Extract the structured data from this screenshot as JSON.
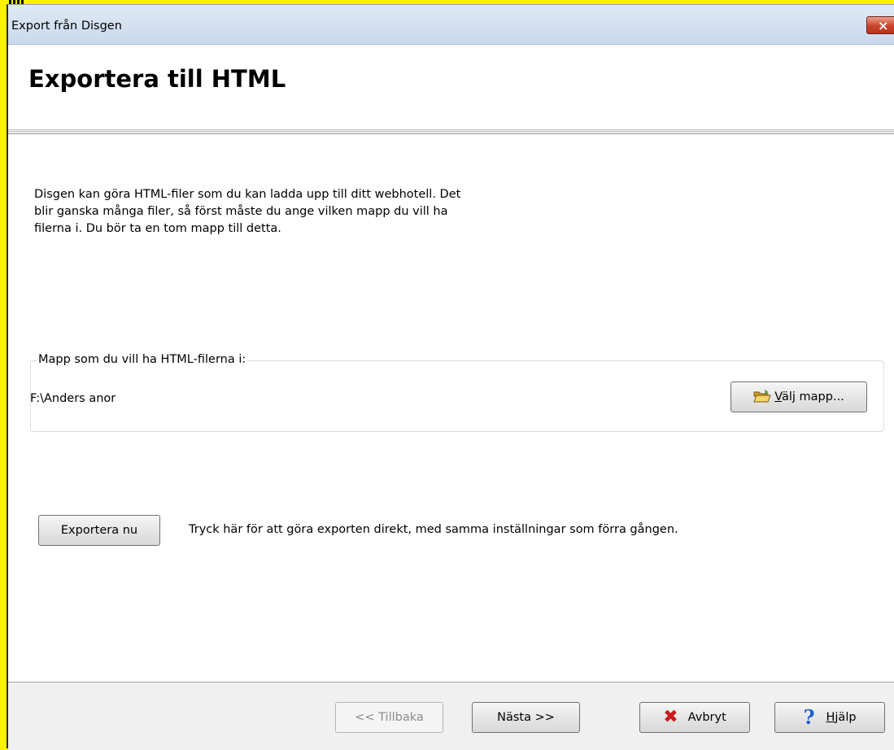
{
  "window": {
    "title": "Export från Disgen",
    "close_label": "×"
  },
  "header": {
    "title": "Exportera till HTML"
  },
  "content": {
    "intro_line1": "Disgen kan göra HTML-filer som du kan ladda upp till ditt webhotell. Det",
    "intro_line2": "blir ganska många filer, så först måste du ange vilken mapp du vill ha",
    "intro_line3": "filerna i. Du bör ta en tom mapp till detta.",
    "folder_group_label": "Mapp som du vill ha HTML-filerna i:",
    "folder_path": "F:\\Anders anor",
    "choose_folder_accel": "V",
    "choose_folder_rest": "älj mapp...",
    "export_now_label": "Exportera nu",
    "export_now_description": "Tryck här för att göra exporten direkt, med samma inställningar som förra gången."
  },
  "footer": {
    "back_label": "<< Tillbaka",
    "next_label": "Nästa >>",
    "cancel_label": "Avbryt",
    "help_accel": "H",
    "help_rest": "jälp"
  },
  "icons": {
    "folder": "open-folder-icon",
    "cancel": "red-x-icon",
    "help": "question-mark-icon"
  }
}
